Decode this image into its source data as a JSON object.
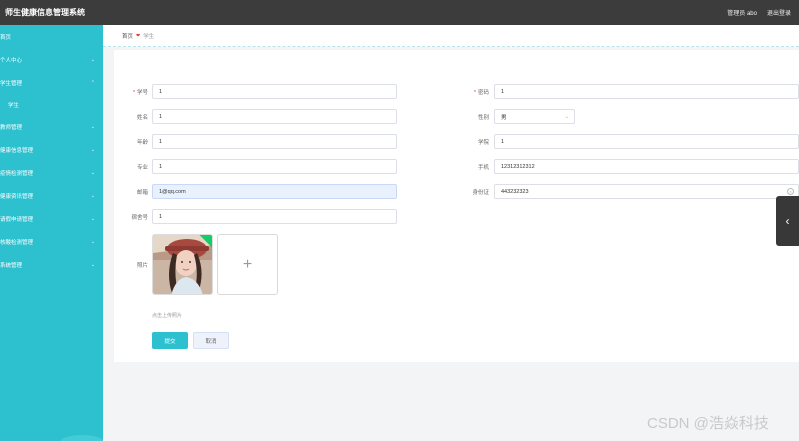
{
  "header": {
    "title": "师生健康信息管理系统",
    "user_label": "管理员 abo",
    "logout_label": "退出登录"
  },
  "sidebar": {
    "items": [
      {
        "label": "首页",
        "expandable": false
      },
      {
        "label": "个人中心",
        "expandable": true
      },
      {
        "label": "学生管理",
        "expandable": true,
        "expanded": true,
        "children": [
          "学生"
        ]
      },
      {
        "label": "教师管理",
        "expandable": true
      },
      {
        "label": "健康信息管理",
        "expandable": true
      },
      {
        "label": "疫情检测管理",
        "expandable": true
      },
      {
        "label": "健康资讯管理",
        "expandable": true
      },
      {
        "label": "请假申请管理",
        "expandable": true
      },
      {
        "label": "核酸检测管理",
        "expandable": true
      },
      {
        "label": "系统管理",
        "expandable": true
      }
    ]
  },
  "breadcrumb": {
    "home": "首页",
    "separator": "❤",
    "current": "学生"
  },
  "form": {
    "student_id_label": "学号",
    "student_id_value": "1",
    "password_label": "密码",
    "password_value": "1",
    "name_label": "姓名",
    "name_value": "1",
    "gender_label": "性别",
    "gender_value": "男",
    "age_label": "年龄",
    "age_value": "1",
    "college_label": "学院",
    "college_value": "1",
    "major_label": "专业",
    "major_value": "1",
    "phone_label": "手机",
    "phone_value": "12312312312",
    "email_label": "邮箱",
    "email_value": "1@qq.com",
    "idcard_label": "身份证",
    "idcard_value": "443232323",
    "dorm_label": "宿舍号",
    "dorm_value": "1",
    "photo_label": "照片",
    "upload_hint": "点击上传照片",
    "submit_label": "提交",
    "cancel_label": "取消"
  },
  "watermark": "CSDN @浩焱科技",
  "colors": {
    "accent": "#2dc0cf",
    "header_bg": "#3c3c3c",
    "required": "#e23b3b"
  }
}
